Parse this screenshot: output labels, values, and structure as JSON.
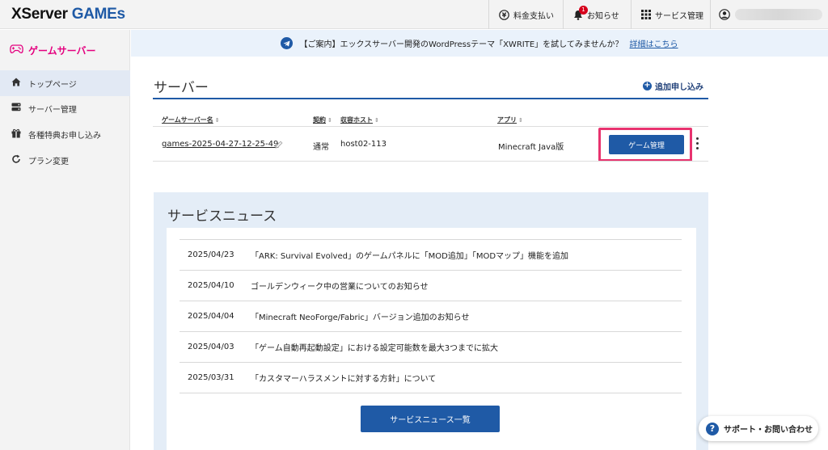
{
  "header": {
    "logo_part1": "XServer",
    "logo_part2": "GAMEs",
    "billing": "料金支払い",
    "notices": "お知らせ",
    "notice_badge": "1",
    "service_mgmt": "サービス管理",
    "user_icon": "user-icon"
  },
  "sidebar": {
    "brand": "ゲームサーバー",
    "items": [
      {
        "label": "トップページ",
        "icon": "home-icon"
      },
      {
        "label": "サーバー管理",
        "icon": "server-icon"
      },
      {
        "label": "各種特典お申し込み",
        "icon": "gift-icon"
      },
      {
        "label": "プラン変更",
        "icon": "refresh-icon"
      }
    ]
  },
  "announcement": {
    "text": "【ご案内】エックスサーバー開発のWordPressテーマ「XWRITE」を試してみませんか？",
    "link": "詳細はこちら"
  },
  "servers": {
    "title": "サーバー",
    "add_label": "追加申し込み",
    "columns": [
      "ゲームサーバー名",
      "契約",
      "収容ホスト",
      "アプリ"
    ],
    "rows": [
      {
        "name": "games-2025-04-27-12-25-49",
        "contract": "通常",
        "host": "host02-113",
        "app": "Minecraft Java版",
        "action": "ゲーム管理"
      }
    ]
  },
  "news": {
    "title": "サービスニュース",
    "items": [
      {
        "date": "2025/04/23",
        "text": "「ARK: Survival Evolved」のゲームパネルに「MOD追加」「MODマップ」機能を追加"
      },
      {
        "date": "2025/04/10",
        "text": "ゴールデンウィーク中の営業についてのお知らせ"
      },
      {
        "date": "2025/04/04",
        "text": "「Minecraft NeoForge/Fabric」バージョン追加のお知らせ"
      },
      {
        "date": "2025/04/03",
        "text": "「ゲーム自動再起動設定」における設定可能数を最大3つまでに拡大"
      },
      {
        "date": "2025/03/31",
        "text": "「カスタマーハラスメントに対する方針」について"
      }
    ],
    "button": "サービスニュース一覧"
  },
  "support": {
    "label": "サポート・お問い合わせ"
  },
  "colors": {
    "brand_blue": "#1f5aa6",
    "brand_pink": "#e4007f",
    "highlight": "#e8336f"
  }
}
